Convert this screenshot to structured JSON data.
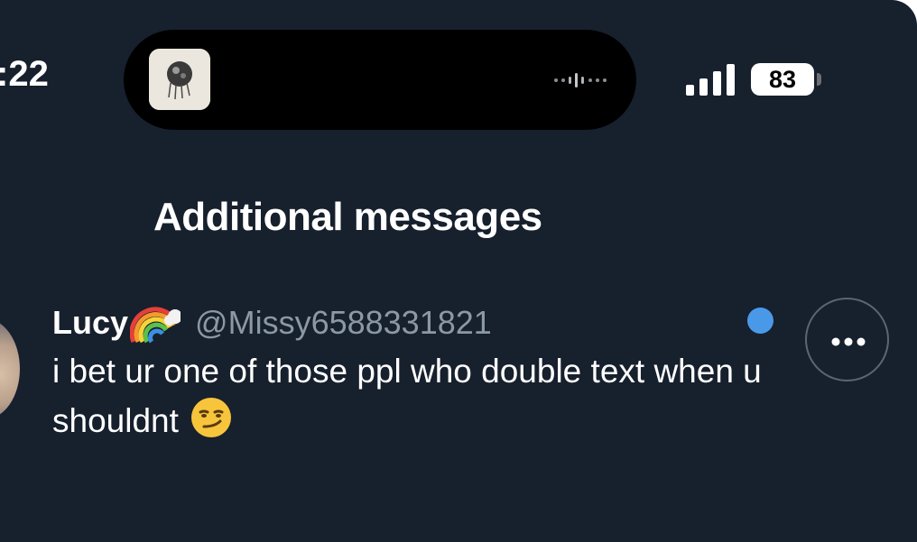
{
  "status_bar": {
    "time": ":22",
    "battery_level": "83",
    "signal_icon": "signal-bars-icon",
    "now_playing_icon": "album-art-icon",
    "waveform_icon": "audio-waveform-icon"
  },
  "section": {
    "title": "Additional messages"
  },
  "message": {
    "author_name": "Lucy",
    "author_emoji_icon": "rainbow-icon",
    "author_handle": "@Missy6588331821",
    "text": "i bet ur one of those ppl who double text when u shouldnt",
    "trailing_emoji_icon": "smirking-face-icon",
    "unread": true,
    "more_icon": "more-horizontal-icon"
  },
  "colors": {
    "background": "#17202d",
    "unread_dot": "#4a99e9",
    "handle_text": "#8b98a5"
  }
}
